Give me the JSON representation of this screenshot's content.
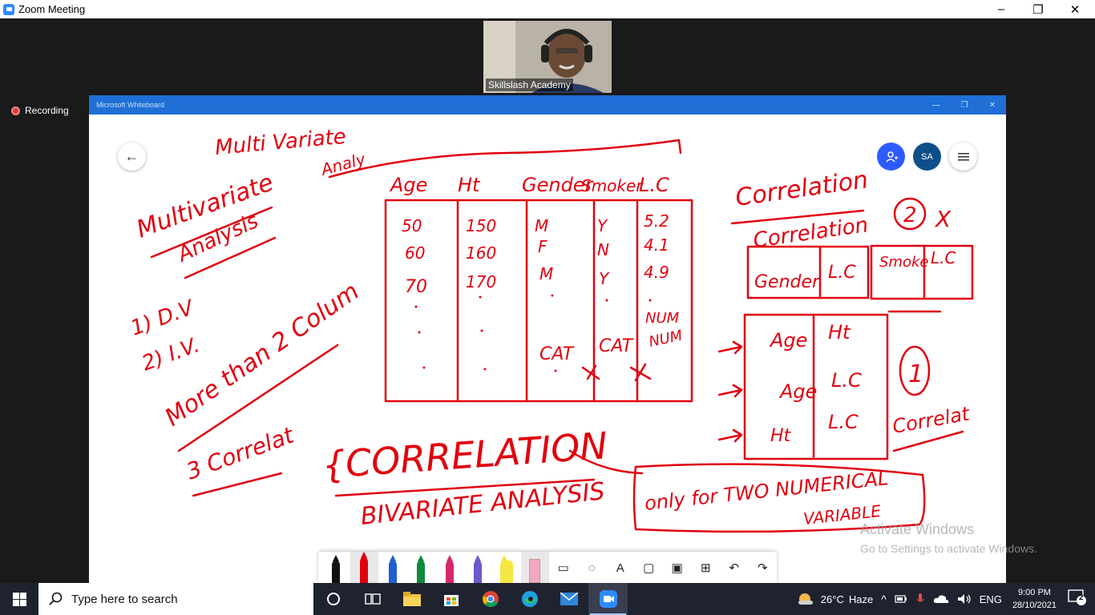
{
  "zoom": {
    "title": "Zoom Meeting",
    "minimize": "–",
    "restore": "❐",
    "close": "✕",
    "recording_label": "Recording",
    "participant_name": "Skillslash Academy"
  },
  "whiteboard": {
    "title": "Microsoft Whiteboard",
    "avatar_initials": "SA",
    "back_icon": "←",
    "ink": {
      "multivariate_top": "Multi Variate",
      "analysis_top": "Analy",
      "multivariate_side": "Multivariate",
      "analysis_side": "Analysis",
      "dv": "1) D.V",
      "iv": "2) I.V.",
      "more_than": "More than 2 Colum",
      "three_correl": "3 Correlat",
      "correlation_caps": "{CORRELATION",
      "bivariate": "BIVARIATE ANALYSIS",
      "only_for": "only for TWO NUMERICAL",
      "variable": "VARIABLE",
      "correlation_top": "Correlation",
      "correlation_mid": "Correlation",
      "mark_two": "2",
      "mark_x": "X",
      "mark_one": "1",
      "correlat_right": "Correlat",
      "table_headers": [
        "Age",
        "Ht",
        "Gender",
        "Smoker",
        "L.C"
      ],
      "table_rows": [
        [
          "50",
          "150",
          "M",
          "Y",
          "5.2"
        ],
        [
          "60",
          "160",
          "F",
          "N",
          "4.1"
        ],
        [
          "70",
          "170",
          "M",
          "Y",
          "4.9"
        ]
      ],
      "type_labels": [
        "CAT",
        "CAT",
        "NUM",
        "NUM"
      ],
      "mini_table_1": [
        "Gender",
        "L.C"
      ],
      "mini_table_2": [
        "Smoke",
        "L.C"
      ],
      "pair_table": [
        [
          "Age",
          "Ht"
        ],
        [
          "Age",
          "L.C"
        ],
        [
          "Ht",
          "L.C"
        ]
      ]
    },
    "toolbar": {
      "pens": [
        {
          "name": "black-pen",
          "color": "#111111"
        },
        {
          "name": "red-pen",
          "color": "#e1000f"
        },
        {
          "name": "blue-pen",
          "color": "#1f5fd1"
        },
        {
          "name": "green-pen",
          "color": "#0e8a3c"
        },
        {
          "name": "pink-pen",
          "color": "#d6286b"
        },
        {
          "name": "galaxy-pen",
          "color": "#6a5acd"
        },
        {
          "name": "highlighter",
          "color": "#f5e642"
        },
        {
          "name": "eraser",
          "color": "#f2a7c3"
        }
      ],
      "icons": [
        "ruler-icon",
        "lasso-icon",
        "text-icon",
        "sticky-note-icon",
        "image-icon",
        "insert-icon",
        "undo-icon",
        "redo-icon"
      ],
      "text_tool_label": "A"
    }
  },
  "watermark": {
    "line1": "Activate Windows",
    "line2": "Go to Settings to activate Windows."
  },
  "taskbar": {
    "search_placeholder": "Type here to search",
    "weather_temp": "26°C",
    "weather_desc": "Haze",
    "language": "ENG",
    "time": "9:00 PM",
    "date": "28/10/2021",
    "notification_count": "2"
  }
}
